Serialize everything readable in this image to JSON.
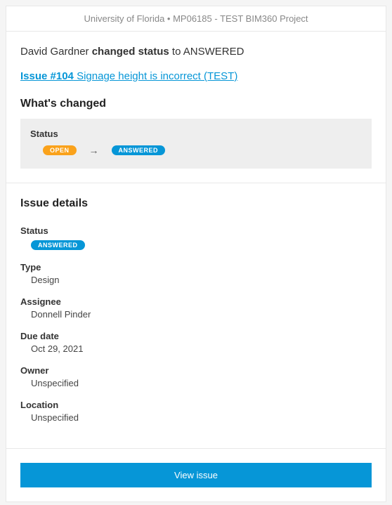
{
  "header": {
    "context": "University of Florida • MP06185 - TEST BIM360 Project"
  },
  "activity": {
    "actor": "David Gardner ",
    "action_bold": "changed status",
    "action_rest": " to ANSWERED",
    "issue_link_bold": "Issue #104",
    "issue_link_rest": " Signage height is incorrect (TEST)"
  },
  "changed": {
    "title": "What's changed",
    "label": "Status",
    "from_badge": "OPEN",
    "arrow": "→",
    "to_badge": "ANSWERED"
  },
  "details": {
    "title": "Issue details",
    "status_label": "Status",
    "status_badge": "ANSWERED",
    "type_label": "Type",
    "type_value": "Design",
    "assignee_label": "Assignee",
    "assignee_value": "Donnell Pinder",
    "duedate_label": "Due date",
    "duedate_value": "Oct 29, 2021",
    "owner_label": "Owner",
    "owner_value": "Unspecified",
    "location_label": "Location",
    "location_value": "Unspecified"
  },
  "button": {
    "label": "View issue"
  }
}
